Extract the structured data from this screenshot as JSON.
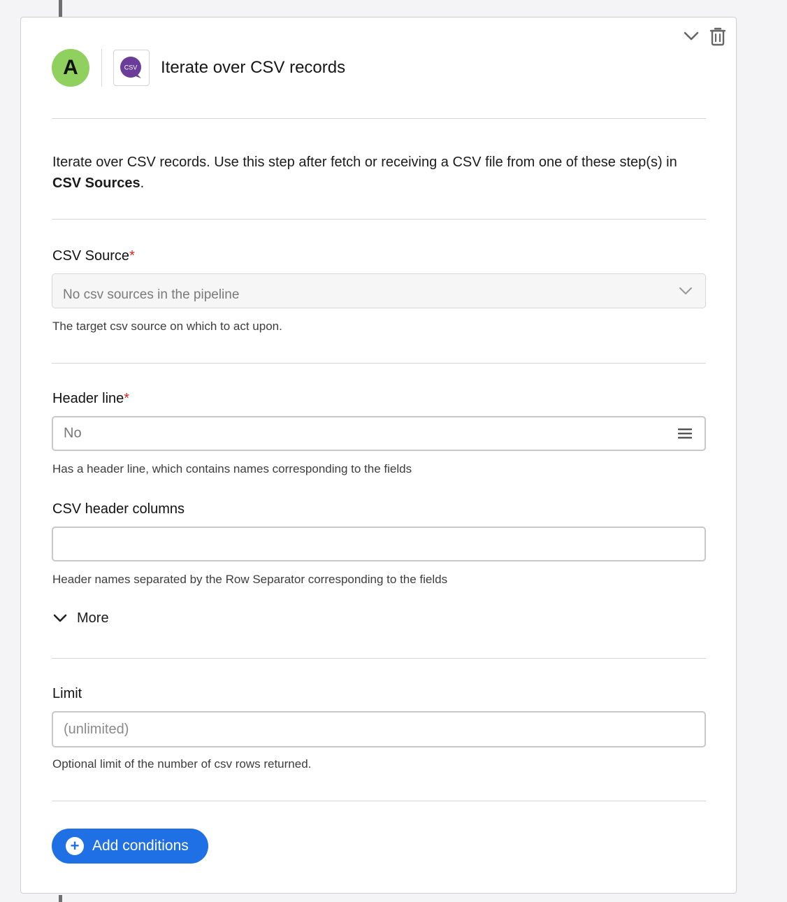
{
  "step": {
    "avatar_letter": "A",
    "app_icon_text": "CSV",
    "title": "Iterate over CSV records",
    "description_prefix": "Iterate over CSV records. Use this step after fetch or receiving a CSV file from one of these step(s) in ",
    "description_link": "CSV Sources",
    "description_suffix": "."
  },
  "fields": {
    "csv_source": {
      "label": "CSV Source",
      "required_mark": "*",
      "value": "No csv sources in the pipeline",
      "help": "The target csv source on which to act upon."
    },
    "header_line": {
      "label": "Header line",
      "required_mark": "*",
      "value": "No",
      "help": "Has a header line, which contains names corresponding to the fields"
    },
    "header_columns": {
      "label": "CSV header columns",
      "value": "",
      "help": "Header names separated by the Row Separator corresponding to the fields"
    },
    "more_label": "More",
    "limit": {
      "label": "Limit",
      "placeholder": "(unlimited)",
      "help": "Optional limit of the number of csv rows returned."
    }
  },
  "actions": {
    "add_conditions": "Add conditions"
  },
  "icons": {
    "collapse": "chevron-down-icon",
    "delete": "trash-icon",
    "select": "chevron-down-icon",
    "list": "list-icon",
    "more": "chevron-down-icon",
    "add": "plus-circle-icon"
  },
  "colors": {
    "avatar": "#8fd05f",
    "primary": "#1f6fe5",
    "required": "#d0281c",
    "csv_brand": "#6a3d9a"
  }
}
